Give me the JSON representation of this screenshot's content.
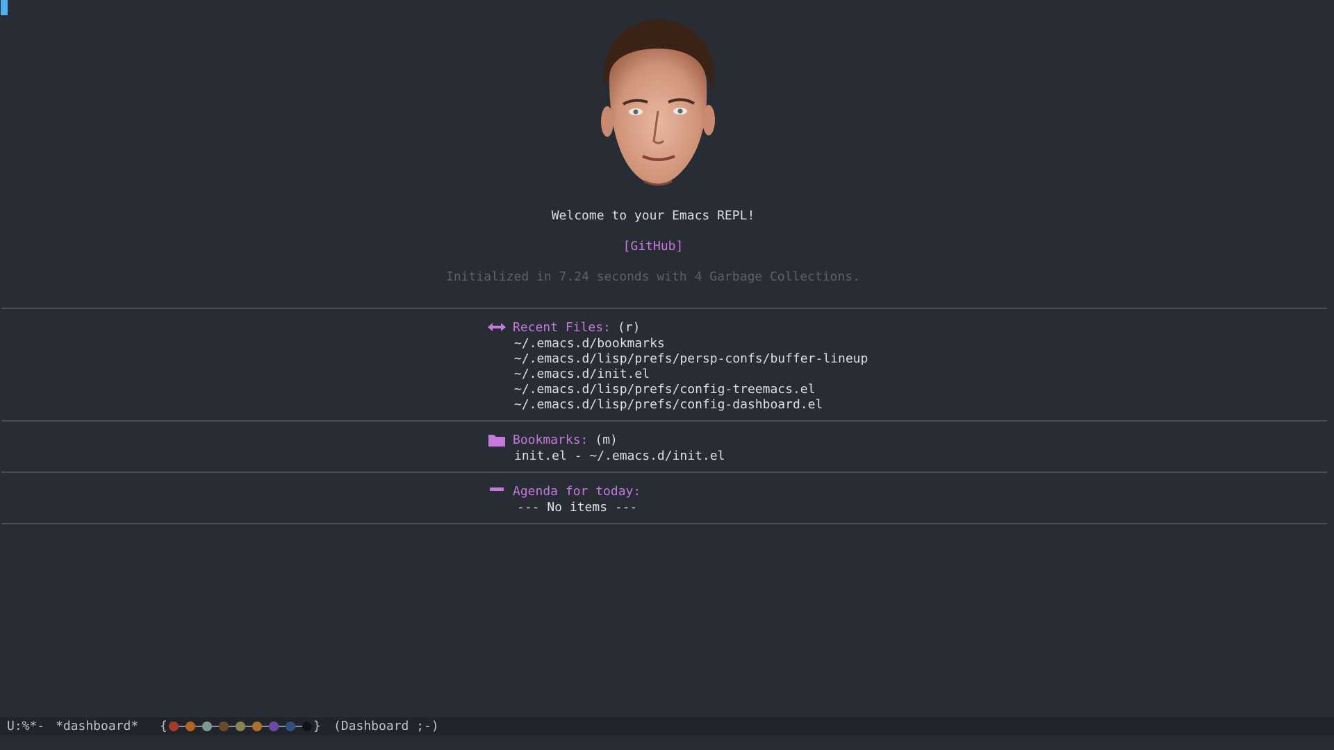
{
  "welcome": "Welcome to your Emacs REPL!",
  "github_link": "[GitHub]",
  "init_message": "Initialized in 7.24 seconds with 4 Garbage Collections.",
  "sections": {
    "recent": {
      "title": "Recent Files:",
      "key": "(r)",
      "icon": "arrows-horizontal-icon",
      "items": [
        "~/.emacs.d/bookmarks",
        "~/.emacs.d/lisp/prefs/persp-confs/buffer-lineup",
        "~/.emacs.d/init.el",
        "~/.emacs.d/lisp/prefs/config-treemacs.el",
        "~/.emacs.d/lisp/prefs/config-dashboard.el"
      ]
    },
    "bookmarks": {
      "title": "Bookmarks:",
      "key": "(m)",
      "icon": "folder-icon",
      "items": [
        "init.el - ~/.emacs.d/init.el"
      ]
    },
    "agenda": {
      "title": "Agenda for today:",
      "icon": "minus-icon",
      "empty": "--- No items ---"
    }
  },
  "modeline": {
    "status": "U:%*-",
    "buffer": "*dashboard*",
    "brace_open": "{",
    "brace_close": "}",
    "mode": "(Dashboard ;-)",
    "planet_colors": [
      "#a33a2a",
      "#b5651d",
      "#7d9a8e",
      "#6b4a2a",
      "#8a8450",
      "#b0702a",
      "#6a4aa8",
      "#2f4f7f",
      "#111318"
    ]
  },
  "colors": {
    "background": "#282c34",
    "accent": "#c678dd",
    "cursor": "#51afef",
    "modeline_bg": "#21242b"
  }
}
